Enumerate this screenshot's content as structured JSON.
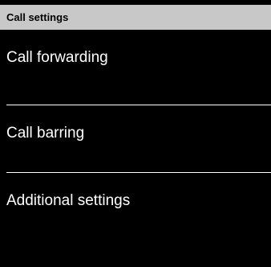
{
  "header": {
    "title": "Call settings",
    "background_color": "#c8c8c8"
  },
  "menu": {
    "items": [
      {
        "label": "Call forwarding"
      },
      {
        "label": "Call barring"
      },
      {
        "label": "Additional settings"
      }
    ],
    "background_color": "#000000",
    "text_color": "#ffffff"
  }
}
